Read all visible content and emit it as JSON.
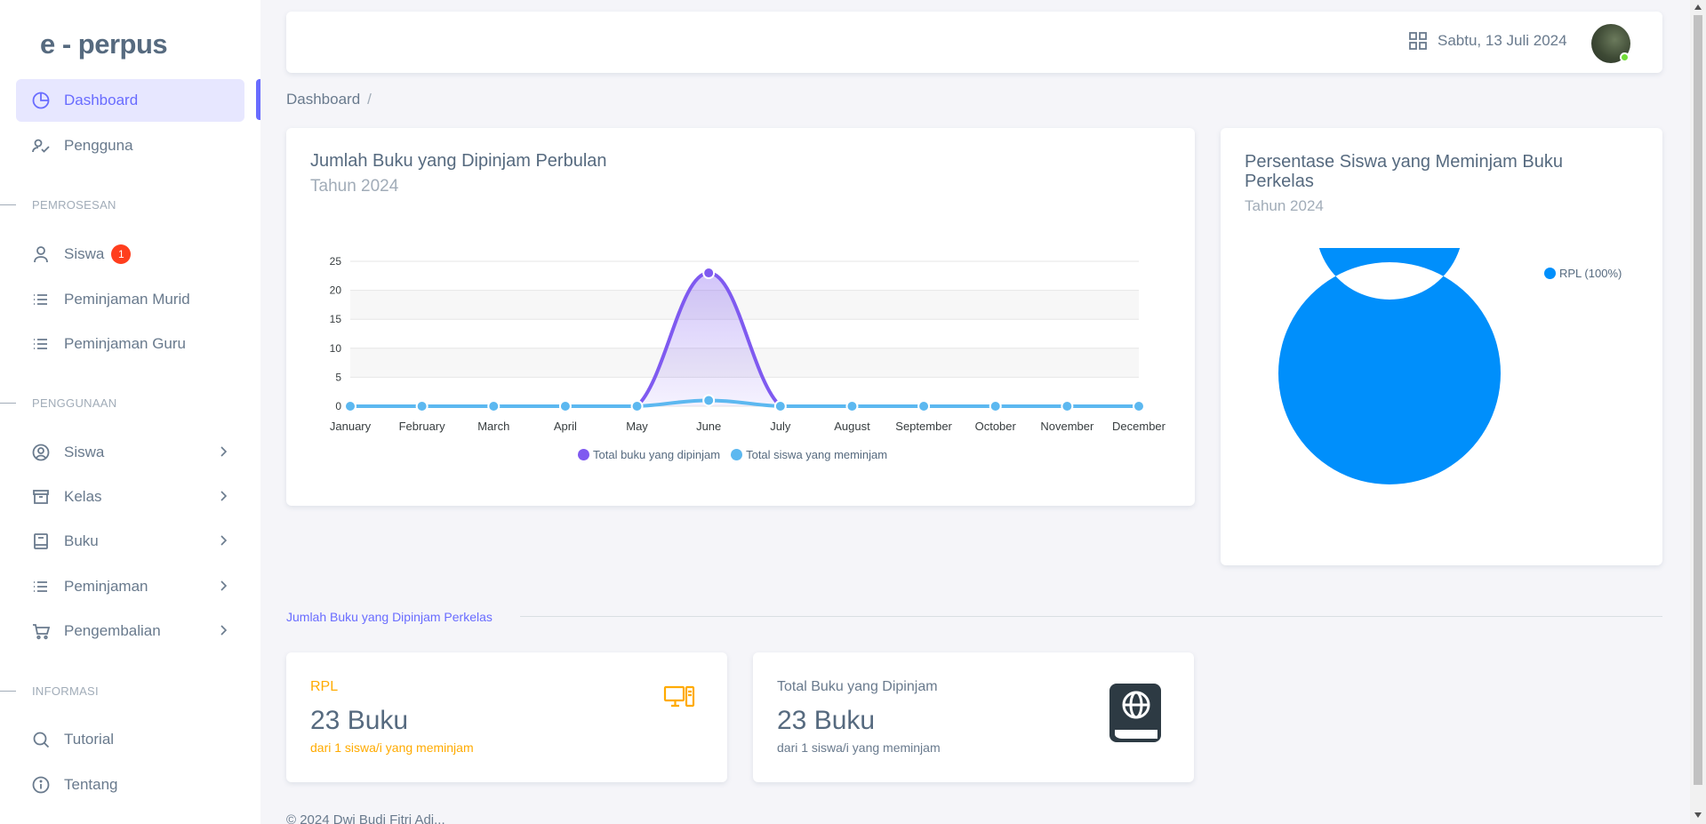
{
  "app": {
    "brand": "e - perpus"
  },
  "sidebar": {
    "items": [
      {
        "label": "Dashboard",
        "icon": "chart-pie-icon",
        "active": true
      },
      {
        "label": "Pengguna",
        "icon": "user-check-icon"
      }
    ],
    "sections": [
      {
        "title": "PEMROSESAN",
        "items": [
          {
            "label": "Siswa",
            "icon": "user-icon",
            "badge": "1"
          },
          {
            "label": "Peminjaman Murid",
            "icon": "list-icon"
          },
          {
            "label": "Peminjaman Guru",
            "icon": "list-icon"
          }
        ]
      },
      {
        "title": "PENGGUNAAN",
        "items": [
          {
            "label": "Siswa",
            "icon": "user-circle-icon"
          },
          {
            "label": "Kelas",
            "icon": "archive-icon"
          },
          {
            "label": "Buku",
            "icon": "book-icon"
          },
          {
            "label": "Peminjaman",
            "icon": "list-icon"
          },
          {
            "label": "Pengembalian",
            "icon": "cart-icon"
          }
        ]
      },
      {
        "title": "INFORMASI",
        "items": [
          {
            "label": "Tutorial",
            "icon": "search-icon"
          },
          {
            "label": "Tentang",
            "icon": "info-icon"
          }
        ]
      }
    ]
  },
  "topbar": {
    "date": "Sabtu, 13 Juli 2024"
  },
  "breadcrumb": {
    "current": "Dashboard",
    "separator": "/"
  },
  "line_card": {
    "title": "Jumlah Buku yang Dipinjam Perbulan",
    "subtitle": "Tahun 2024"
  },
  "donut_card": {
    "title_line1": "Persentase Siswa yang Meminjam Buku",
    "title_line2": "Perkelas",
    "subtitle": "Tahun 2024"
  },
  "chart_data": [
    {
      "type": "area",
      "categories": [
        "January",
        "February",
        "March",
        "April",
        "May",
        "June",
        "July",
        "August",
        "September",
        "October",
        "November",
        "December"
      ],
      "series": [
        {
          "name": "Total buku yang dipinjam",
          "color": "#7f5af0",
          "values": [
            0,
            0,
            0,
            0,
            0,
            23,
            0,
            0,
            0,
            0,
            0,
            0
          ]
        },
        {
          "name": "Total siswa yang meminjam",
          "color": "#5cb8f0",
          "values": [
            0,
            0,
            0,
            0,
            0,
            1,
            0,
            0,
            0,
            0,
            0,
            0
          ]
        }
      ],
      "yticks": [
        0,
        5,
        10,
        15,
        20,
        25
      ],
      "ylim": [
        0,
        25
      ],
      "grid": true,
      "legend": "bottom"
    },
    {
      "type": "pie",
      "categories": [
        "RPL (100%)"
      ],
      "values": [
        100
      ],
      "colors": [
        "#008ffb"
      ],
      "legend": "top-right"
    }
  ],
  "section_divider": {
    "label": "Jumlah Buku yang Dipinjam Perkelas"
  },
  "stats": [
    {
      "label": "RPL",
      "value": "23 Buku",
      "desc": "dari 1 siswa/i yang meminjam",
      "color": "#ffab00",
      "icon": "computer-icon"
    },
    {
      "label": "Total Buku yang Dipinjam",
      "value": "23 Buku",
      "desc": "dari 1 siswa/i yang meminjam",
      "color": "#697a8d",
      "icon": "book-globe-icon"
    }
  ],
  "footer": {
    "text": "© 2024 Dwi Budi Fitri Adi..."
  }
}
